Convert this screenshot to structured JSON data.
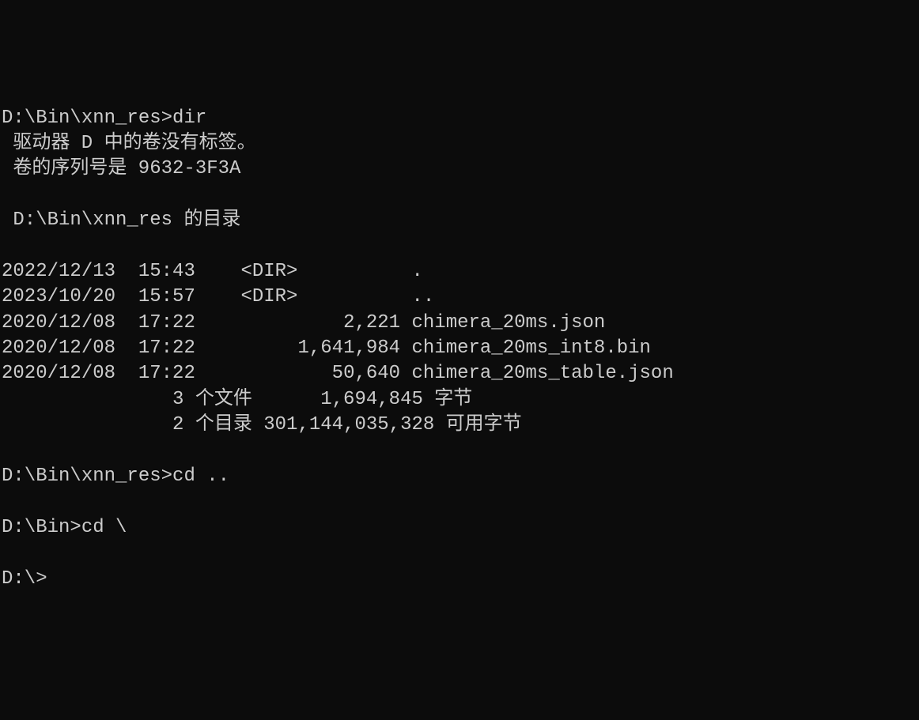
{
  "session": {
    "lines": [
      {
        "type": "prompt",
        "prompt": "D:\\Bin\\xnn_res>",
        "command": "dir"
      },
      {
        "type": "output",
        "text": " 驱动器 D 中的卷没有标签。"
      },
      {
        "type": "output",
        "text": " 卷的序列号是 9632-3F3A"
      },
      {
        "type": "output",
        "text": ""
      },
      {
        "type": "output",
        "text": " D:\\Bin\\xnn_res 的目录"
      },
      {
        "type": "output",
        "text": ""
      },
      {
        "type": "output",
        "text": "2022/12/13  15:43    <DIR>          ."
      },
      {
        "type": "output",
        "text": "2023/10/20  15:57    <DIR>          .."
      },
      {
        "type": "output",
        "text": "2020/12/08  17:22             2,221 chimera_20ms.json"
      },
      {
        "type": "output",
        "text": "2020/12/08  17:22         1,641,984 chimera_20ms_int8.bin"
      },
      {
        "type": "output",
        "text": "2020/12/08  17:22            50,640 chimera_20ms_table.json"
      },
      {
        "type": "output",
        "text": "               3 个文件      1,694,845 字节"
      },
      {
        "type": "output",
        "text": "               2 个目录 301,144,035,328 可用字节"
      },
      {
        "type": "output",
        "text": ""
      },
      {
        "type": "prompt",
        "prompt": "D:\\Bin\\xnn_res>",
        "command": "cd .."
      },
      {
        "type": "output",
        "text": ""
      },
      {
        "type": "prompt",
        "prompt": "D:\\Bin>",
        "command": "cd \\"
      },
      {
        "type": "output",
        "text": ""
      },
      {
        "type": "prompt",
        "prompt": "D:\\>",
        "command": ""
      }
    ]
  },
  "dir_listing": {
    "drive": "D",
    "volume_label_text": "驱动器 D 中的卷没有标签。",
    "serial_label": "卷的序列号是",
    "serial": "9632-3F3A",
    "path": "D:\\Bin\\xnn_res",
    "directory_of_label": "的目录",
    "entries": [
      {
        "date": "2022/12/13",
        "time": "15:43",
        "attr": "<DIR>",
        "size": "",
        "name": "."
      },
      {
        "date": "2023/10/20",
        "time": "15:57",
        "attr": "<DIR>",
        "size": "",
        "name": ".."
      },
      {
        "date": "2020/12/08",
        "time": "17:22",
        "attr": "",
        "size": "2,221",
        "name": "chimera_20ms.json"
      },
      {
        "date": "2020/12/08",
        "time": "17:22",
        "attr": "",
        "size": "1,641,984",
        "name": "chimera_20ms_int8.bin"
      },
      {
        "date": "2020/12/08",
        "time": "17:22",
        "attr": "",
        "size": "50,640",
        "name": "chimera_20ms_table.json"
      }
    ],
    "summary": {
      "file_count": 3,
      "file_count_label": "个文件",
      "total_bytes": "1,694,845",
      "bytes_label": "字节",
      "dir_count": 2,
      "dir_count_label": "个目录",
      "free_bytes": "301,144,035,328",
      "free_label": "可用字节"
    }
  }
}
